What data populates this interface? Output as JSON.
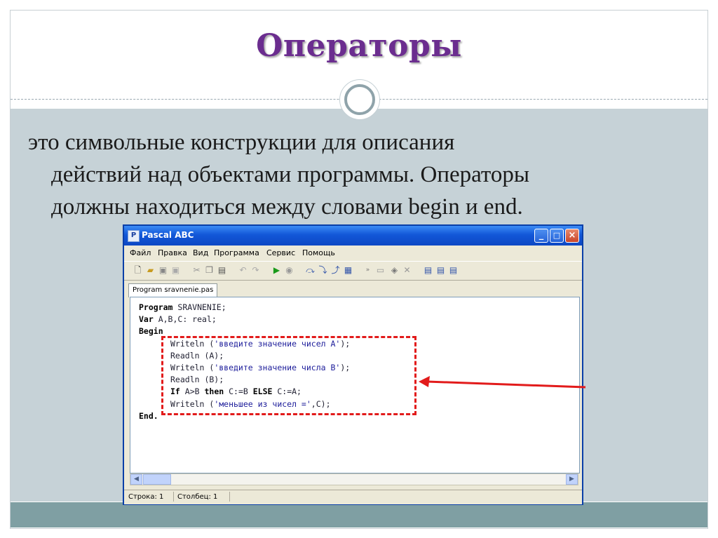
{
  "slide": {
    "title": "Операторы",
    "lines": [
      "это символьные конструкции для описания",
      "действий над объектами программы. Операторы",
      "должны находиться между словами begin и end."
    ]
  },
  "window": {
    "title": "Pascal ABC",
    "app_icon": "pascal-abc-app-icon",
    "controls": {
      "minimize": "_",
      "maximize": "□",
      "close": "×"
    },
    "menu": [
      "Файл",
      "Правка",
      "Вид",
      "Программа",
      "Сервис",
      "Помощь"
    ],
    "toolbar_icons": [
      "new-file-icon",
      "open-file-icon",
      "save-icon",
      "save-all-icon",
      "cut-icon",
      "copy-icon",
      "paste-icon",
      "undo-icon",
      "redo-icon",
      "run-icon",
      "stop-icon",
      "step-over-icon",
      "step-into-icon",
      "step-out-icon",
      "breakpoint-icon",
      "watch-icon",
      "output-window-icon",
      "toggle-icon",
      "close-debug-icon",
      "compile-icon",
      "compile-all-icon",
      "options-icon"
    ],
    "tab": "Program sravnenie.pas",
    "code": {
      "l1_kw": "Program",
      "l1_tx": " SRAVNENIE;",
      "l2_kw": "Var",
      "l2_tx": " A,B,C: real;",
      "l3_kw": "Begin",
      "l4_a": "Writeln (",
      "l4_str": "'введите значение чисел А'",
      "l4_b": ");",
      "l5": "Readln (A);",
      "l6_a": "Writeln (",
      "l6_str": "'введите значение числа В'",
      "l6_b": ");",
      "l7": "Readln (B);",
      "l8_kw1": "If",
      "l8_t1": " A>B ",
      "l8_kw2": "then",
      "l8_t2": " C:=B ",
      "l8_kw3": "ELSE",
      "l8_t3": " C:=A;",
      "l9_a": "Writeln (",
      "l9_str": "'меньшее из чисел ='",
      "l9_b": ",C);",
      "l10_kw": "End."
    },
    "status": {
      "row": "Строка: 1",
      "col": "Столбец: 1"
    }
  },
  "colors": {
    "title": "#6b2d8f",
    "content_bg": "#c6d2d7",
    "band": "#7f9fa3",
    "highlight": "#e21b1b"
  }
}
